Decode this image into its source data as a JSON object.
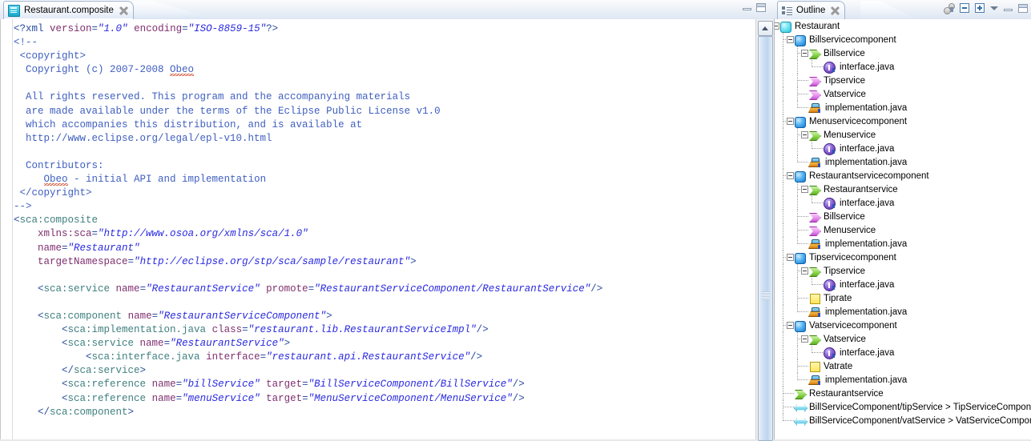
{
  "editor": {
    "tab": {
      "title": "Restaurant.composite",
      "icon": "xml-document-icon",
      "close_icon": "close-icon"
    },
    "window_buttons": {
      "minimize": "minimize-icon",
      "maximize": "maximize-icon"
    },
    "code_lines": [
      [
        {
          "t": "<?xml ",
          "c": "pi"
        },
        {
          "t": "version",
          "c": "attr"
        },
        {
          "t": "=",
          "c": "punct"
        },
        {
          "t": "\"1.0\"",
          "c": "val"
        },
        {
          "t": " ",
          "c": "punct"
        },
        {
          "t": "encoding",
          "c": "attr"
        },
        {
          "t": "=",
          "c": "punct"
        },
        {
          "t": "\"ISO-8859-15\"",
          "c": "val"
        },
        {
          "t": "?>",
          "c": "pi"
        }
      ],
      [
        {
          "t": "<!--",
          "c": "cmt"
        }
      ],
      [
        {
          "t": " <copyright>",
          "c": "cmt"
        }
      ],
      [
        {
          "t": "  Copyright (c) 2007-2008 ",
          "c": "cmt"
        },
        {
          "t": "Obeo",
          "c": "cmt sp"
        }
      ],
      [
        {
          "t": "",
          "c": "cmt"
        }
      ],
      [
        {
          "t": "  All rights reserved. This program and the accompanying materials",
          "c": "cmt"
        }
      ],
      [
        {
          "t": "  are made available under the terms of the Eclipse Public License v1.0",
          "c": "cmt"
        }
      ],
      [
        {
          "t": "  which accompanies this distribution, and is available at",
          "c": "cmt"
        }
      ],
      [
        {
          "t": "  http://www.eclipse.org/legal/epl-v10.html",
          "c": "cmt"
        }
      ],
      [
        {
          "t": "",
          "c": "cmt"
        }
      ],
      [
        {
          "t": "  Contributors:",
          "c": "cmt"
        }
      ],
      [
        {
          "t": "     ",
          "c": "cmt"
        },
        {
          "t": "Obeo",
          "c": "cmt sp"
        },
        {
          "t": " - initial API and implementation",
          "c": "cmt"
        }
      ],
      [
        {
          "t": " </copyright>",
          "c": "cmt"
        }
      ],
      [
        {
          "t": "-->",
          "c": "cmt"
        }
      ],
      [
        {
          "t": "<",
          "c": "punct"
        },
        {
          "t": "sca:composite",
          "c": "tag"
        }
      ],
      [
        {
          "t": "    ",
          "c": "punct"
        },
        {
          "t": "xmlns:sca",
          "c": "attr"
        },
        {
          "t": "=",
          "c": "punct"
        },
        {
          "t": "\"http://www.osoa.org/xmlns/sca/1.0\"",
          "c": "val"
        }
      ],
      [
        {
          "t": "    ",
          "c": "punct"
        },
        {
          "t": "name",
          "c": "attr"
        },
        {
          "t": "=",
          "c": "punct"
        },
        {
          "t": "\"Restaurant\"",
          "c": "val"
        }
      ],
      [
        {
          "t": "    ",
          "c": "punct"
        },
        {
          "t": "targetNamespace",
          "c": "attr"
        },
        {
          "t": "=",
          "c": "punct"
        },
        {
          "t": "\"http://eclipse.org/stp/sca/sample/restaurant\"",
          "c": "val"
        },
        {
          "t": ">",
          "c": "punct"
        }
      ],
      [
        {
          "t": "",
          "c": "punct"
        }
      ],
      [
        {
          "t": "    <",
          "c": "punct"
        },
        {
          "t": "sca:service",
          "c": "tag"
        },
        {
          "t": " ",
          "c": "punct"
        },
        {
          "t": "name",
          "c": "attr"
        },
        {
          "t": "=",
          "c": "punct"
        },
        {
          "t": "\"RestaurantService\"",
          "c": "val"
        },
        {
          "t": " ",
          "c": "punct"
        },
        {
          "t": "promote",
          "c": "attr"
        },
        {
          "t": "=",
          "c": "punct"
        },
        {
          "t": "\"RestaurantServiceComponent/RestaurantService\"",
          "c": "val"
        },
        {
          "t": "/>",
          "c": "punct"
        }
      ],
      [
        {
          "t": "",
          "c": "punct"
        }
      ],
      [
        {
          "t": "    <",
          "c": "punct"
        },
        {
          "t": "sca:component",
          "c": "tag"
        },
        {
          "t": " ",
          "c": "punct"
        },
        {
          "t": "name",
          "c": "attr"
        },
        {
          "t": "=",
          "c": "punct"
        },
        {
          "t": "\"RestaurantServiceComponent\"",
          "c": "val"
        },
        {
          "t": ">",
          "c": "punct"
        }
      ],
      [
        {
          "t": "        <",
          "c": "punct"
        },
        {
          "t": "sca:implementation.java",
          "c": "tag"
        },
        {
          "t": " ",
          "c": "punct"
        },
        {
          "t": "class",
          "c": "attr"
        },
        {
          "t": "=",
          "c": "punct"
        },
        {
          "t": "\"restaurant.lib.RestaurantServiceImpl\"",
          "c": "val"
        },
        {
          "t": "/>",
          "c": "punct"
        }
      ],
      [
        {
          "t": "        <",
          "c": "punct"
        },
        {
          "t": "sca:service",
          "c": "tag"
        },
        {
          "t": " ",
          "c": "punct"
        },
        {
          "t": "name",
          "c": "attr"
        },
        {
          "t": "=",
          "c": "punct"
        },
        {
          "t": "\"RestaurantService\"",
          "c": "val"
        },
        {
          "t": ">",
          "c": "punct"
        }
      ],
      [
        {
          "t": "            <",
          "c": "punct"
        },
        {
          "t": "sca:interface.java",
          "c": "tag"
        },
        {
          "t": " ",
          "c": "punct"
        },
        {
          "t": "interface",
          "c": "attr"
        },
        {
          "t": "=",
          "c": "punct"
        },
        {
          "t": "\"restaurant.api.RestaurantService\"",
          "c": "val"
        },
        {
          "t": "/>",
          "c": "punct"
        }
      ],
      [
        {
          "t": "        </",
          "c": "punct"
        },
        {
          "t": "sca:service",
          "c": "tag"
        },
        {
          "t": ">",
          "c": "punct"
        }
      ],
      [
        {
          "t": "        <",
          "c": "punct"
        },
        {
          "t": "sca:reference",
          "c": "tag"
        },
        {
          "t": " ",
          "c": "punct"
        },
        {
          "t": "name",
          "c": "attr"
        },
        {
          "t": "=",
          "c": "punct"
        },
        {
          "t": "\"billService\"",
          "c": "val"
        },
        {
          "t": " ",
          "c": "punct"
        },
        {
          "t": "target",
          "c": "attr"
        },
        {
          "t": "=",
          "c": "punct"
        },
        {
          "t": "\"BillServiceComponent/BillService\"",
          "c": "val"
        },
        {
          "t": "/>",
          "c": "punct"
        }
      ],
      [
        {
          "t": "        <",
          "c": "punct"
        },
        {
          "t": "sca:reference",
          "c": "tag"
        },
        {
          "t": " ",
          "c": "punct"
        },
        {
          "t": "name",
          "c": "attr"
        },
        {
          "t": "=",
          "c": "punct"
        },
        {
          "t": "\"menuService\"",
          "c": "val"
        },
        {
          "t": " ",
          "c": "punct"
        },
        {
          "t": "target",
          "c": "attr"
        },
        {
          "t": "=",
          "c": "punct"
        },
        {
          "t": "\"MenuServiceComponent/MenuService\"",
          "c": "val"
        },
        {
          "t": "/>",
          "c": "punct"
        }
      ],
      [
        {
          "t": "    </",
          "c": "punct"
        },
        {
          "t": "sca:component",
          "c": "tag"
        },
        {
          "t": ">",
          "c": "punct"
        }
      ]
    ],
    "scrollbar": {
      "up_arrow": "scroll-up-icon"
    }
  },
  "outline": {
    "tab": {
      "title": "Outline",
      "icon": "outline-icon",
      "close_icon": "close-icon"
    },
    "toolbar": [
      {
        "name": "sort-filter-button",
        "icon": "sort-filter-icon"
      },
      {
        "name": "collapse-all-button",
        "icon": "collapse-all-icon"
      },
      {
        "name": "expand-all-button",
        "icon": "expand-all-icon"
      },
      {
        "name": "view-menu-button",
        "icon": "chevron-down-icon"
      },
      {
        "name": "minimize-button",
        "icon": "minimize-icon"
      },
      {
        "name": "maximize-button",
        "icon": "maximize-icon"
      }
    ],
    "tree": [
      {
        "label": "Restaurant",
        "icon": "composite",
        "depth": 0,
        "expander": "expanded"
      },
      {
        "label": "Billservicecomponent",
        "icon": "component",
        "depth": 1,
        "expander": "expanded"
      },
      {
        "label": "Billservice",
        "icon": "service",
        "depth": 2,
        "expander": "expanded"
      },
      {
        "label": "interface.java",
        "icon": "interface",
        "depth": 3,
        "expander": "none"
      },
      {
        "label": "Tipservice",
        "icon": "reference",
        "depth": 2,
        "expander": "none"
      },
      {
        "label": "Vatservice",
        "icon": "reference",
        "depth": 2,
        "expander": "none"
      },
      {
        "label": "implementation.java",
        "icon": "impl",
        "depth": 2,
        "expander": "none"
      },
      {
        "label": "Menuservicecomponent",
        "icon": "component",
        "depth": 1,
        "expander": "expanded"
      },
      {
        "label": "Menuservice",
        "icon": "service",
        "depth": 2,
        "expander": "expanded"
      },
      {
        "label": "interface.java",
        "icon": "interface",
        "depth": 3,
        "expander": "none"
      },
      {
        "label": "implementation.java",
        "icon": "impl",
        "depth": 2,
        "expander": "none"
      },
      {
        "label": "Restaurantservicecomponent",
        "icon": "component",
        "depth": 1,
        "expander": "expanded"
      },
      {
        "label": "Restaurantservice",
        "icon": "service",
        "depth": 2,
        "expander": "expanded"
      },
      {
        "label": "interface.java",
        "icon": "interface",
        "depth": 3,
        "expander": "none"
      },
      {
        "label": "Billservice",
        "icon": "reference",
        "depth": 2,
        "expander": "none"
      },
      {
        "label": "Menuservice",
        "icon": "reference",
        "depth": 2,
        "expander": "none"
      },
      {
        "label": "implementation.java",
        "icon": "impl",
        "depth": 2,
        "expander": "none"
      },
      {
        "label": "Tipservicecomponent",
        "icon": "component",
        "depth": 1,
        "expander": "expanded"
      },
      {
        "label": "Tipservice",
        "icon": "service",
        "depth": 2,
        "expander": "expanded"
      },
      {
        "label": "interface.java",
        "icon": "interface",
        "depth": 3,
        "expander": "none"
      },
      {
        "label": "Tiprate",
        "icon": "property",
        "depth": 2,
        "expander": "none"
      },
      {
        "label": "implementation.java",
        "icon": "impl",
        "depth": 2,
        "expander": "none"
      },
      {
        "label": "Vatservicecomponent",
        "icon": "component",
        "depth": 1,
        "expander": "expanded"
      },
      {
        "label": "Vatservice",
        "icon": "service",
        "depth": 2,
        "expander": "expanded"
      },
      {
        "label": "interface.java",
        "icon": "interface",
        "depth": 3,
        "expander": "none"
      },
      {
        "label": "Vatrate",
        "icon": "property",
        "depth": 2,
        "expander": "none"
      },
      {
        "label": "implementation.java",
        "icon": "impl",
        "depth": 2,
        "expander": "none"
      },
      {
        "label": "Restaurantservice",
        "icon": "service",
        "depth": 1,
        "expander": "none"
      },
      {
        "label": "BillServiceComponent/tipService > TipServiceComponent/TipService",
        "icon": "wire",
        "depth": 1,
        "expander": "none"
      },
      {
        "label": "BillServiceComponent/vatService > VatServiceComponent/VatService",
        "icon": "wire",
        "depth": 1,
        "expander": "none"
      }
    ]
  }
}
